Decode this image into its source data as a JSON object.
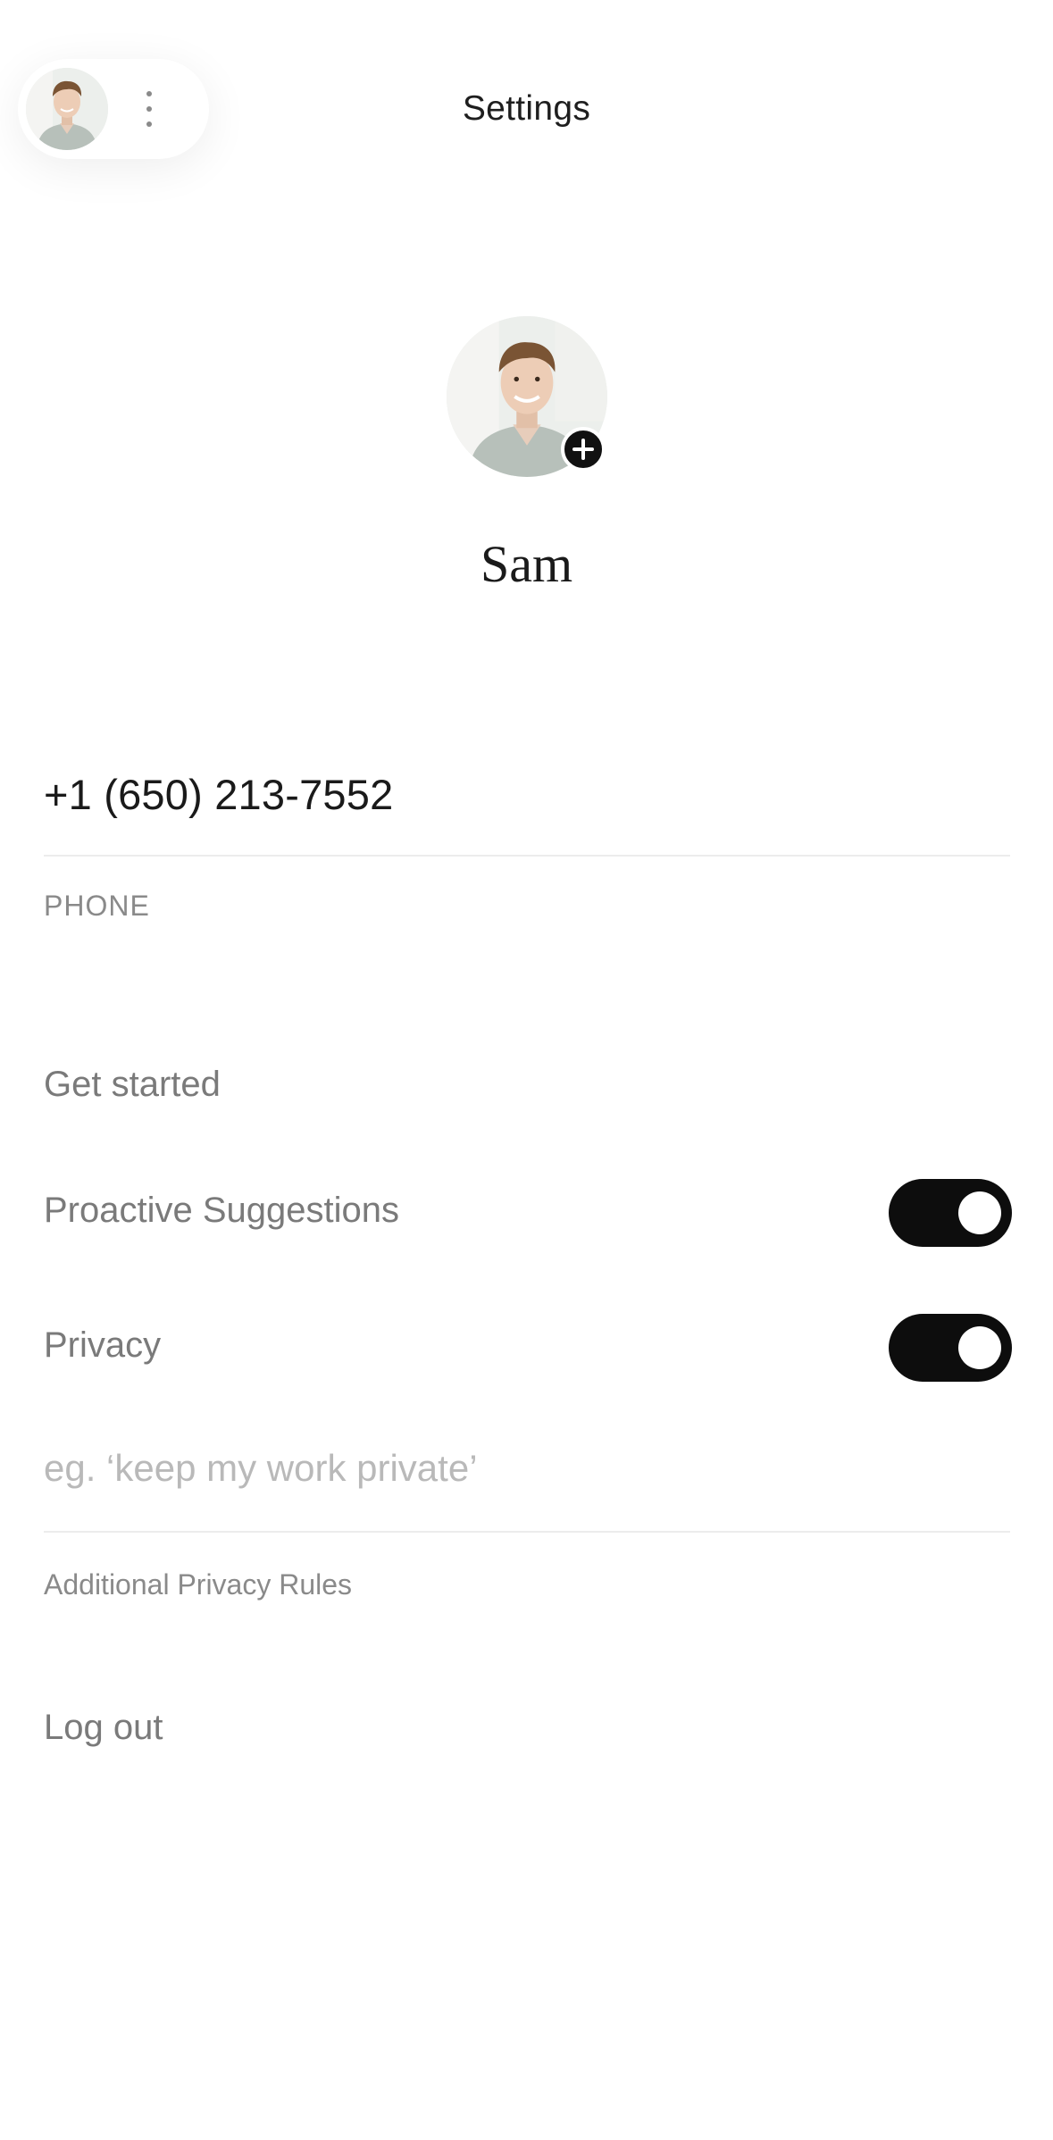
{
  "header": {
    "title": "Settings",
    "account_menu_icon": "kebab-vertical-icon"
  },
  "profile": {
    "name": "Sam",
    "add_photo_icon": "plus-circle-icon"
  },
  "phone": {
    "value": "+1 (650) 213-7552",
    "label": "PHONE"
  },
  "menu": {
    "get_started": "Get started",
    "proactive_suggestions": {
      "label": "Proactive Suggestions",
      "enabled": true
    },
    "privacy": {
      "label": "Privacy",
      "enabled": true
    }
  },
  "privacy_rules": {
    "placeholder": "eg. ‘keep my work private’",
    "value": "",
    "label": "Additional Privacy Rules"
  },
  "logout": {
    "label": "Log out"
  },
  "colors": {
    "toggle_on": "#0d0d0d",
    "muted_text": "#7a7a7a",
    "placeholder": "#b9b9b9"
  }
}
